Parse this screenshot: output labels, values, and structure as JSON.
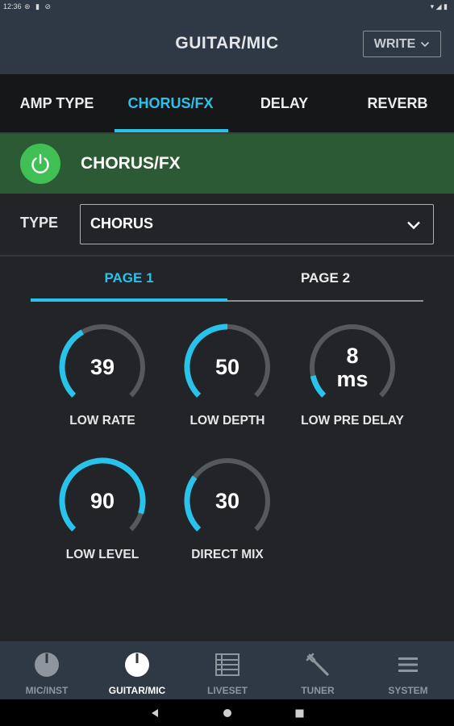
{
  "status_bar": {
    "time": "12:36",
    "left_icons": "⊛ ▮ ⊘",
    "right_icons": "▾ ◢ ▮"
  },
  "header": {
    "title": "GUITAR/MIC",
    "write_label": "WRITE"
  },
  "tabs": [
    {
      "label": "AMP TYPE"
    },
    {
      "label": "CHORUS/FX"
    },
    {
      "label": "DELAY"
    },
    {
      "label": "REVERB"
    }
  ],
  "active_tab": "CHORUS/FX",
  "fx": {
    "title": "CHORUS/FX",
    "enabled": true,
    "color": "#2c5a34"
  },
  "type": {
    "label": "TYPE",
    "value": "CHORUS"
  },
  "pages": [
    {
      "label": "PAGE 1"
    },
    {
      "label": "PAGE 2"
    }
  ],
  "active_page": "PAGE 1",
  "knobs": [
    {
      "label": "LOW RATE",
      "value": "39",
      "unit": "",
      "fraction": 0.39
    },
    {
      "label": "LOW DEPTH",
      "value": "50",
      "unit": "",
      "fraction": 0.5
    },
    {
      "label": "LOW PRE DELAY",
      "value": "8",
      "unit": "ms",
      "fraction": 0.12
    },
    {
      "label": "LOW LEVEL",
      "value": "90",
      "unit": "",
      "fraction": 0.9
    },
    {
      "label": "DIRECT MIX",
      "value": "30",
      "unit": "",
      "fraction": 0.3
    }
  ],
  "nav": [
    {
      "label": "MIC/INST",
      "icon": "knob-icon"
    },
    {
      "label": "GUITAR/MIC",
      "icon": "knob-icon"
    },
    {
      "label": "LIVESET",
      "icon": "list-icon"
    },
    {
      "label": "TUNER",
      "icon": "tuning-fork-icon"
    },
    {
      "label": "SYSTEM",
      "icon": "menu-icon"
    }
  ],
  "active_nav": "GUITAR/MIC",
  "colors": {
    "accent": "#29c2ea",
    "power_on": "#3fbf54",
    "header_bg": "#2f3845"
  }
}
